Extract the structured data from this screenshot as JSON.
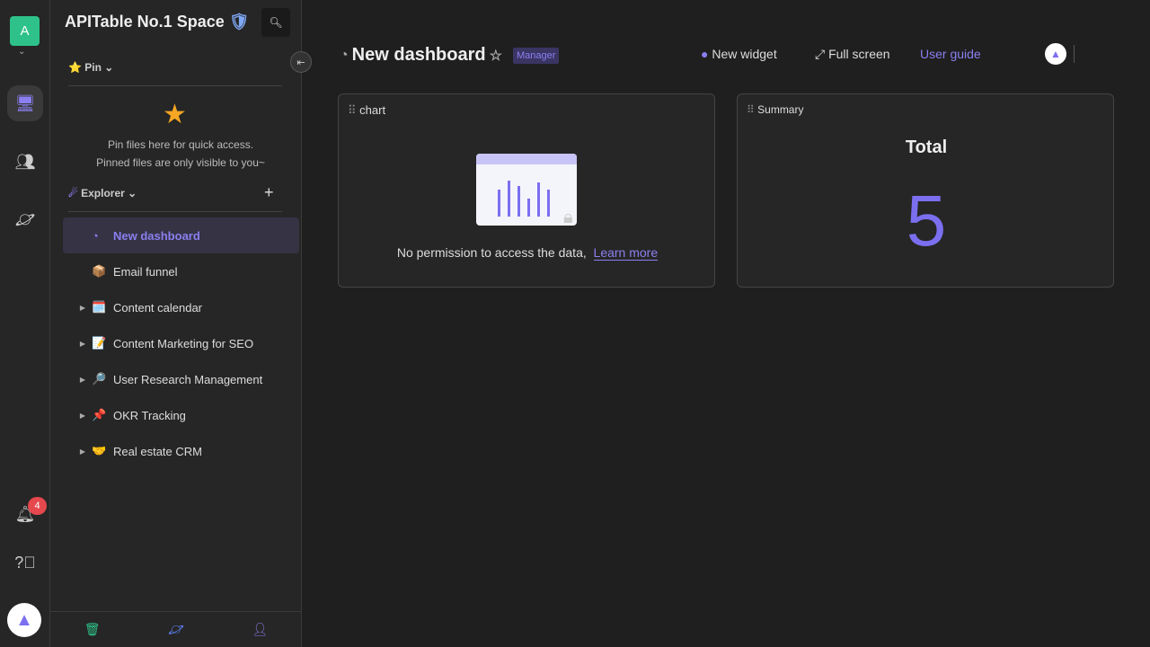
{
  "rail": {
    "avatar_letter": "A",
    "notification_count": "4"
  },
  "sidebar": {
    "space_name": "APITable No.1 Space",
    "pin_label": "Pin",
    "pin_msg1": "Pin files here for quick access.",
    "pin_msg2": "Pinned files are only visible to you~",
    "explorer_label": "Explorer",
    "items": [
      {
        "label": "New dashboard",
        "icon": "dashboard-icon",
        "active": true
      },
      {
        "label": "Email funnel",
        "emoji": "📦"
      },
      {
        "label": "Content calendar",
        "emoji": "🗓️"
      },
      {
        "label": "Content Marketing for SEO",
        "emoji": "📝"
      },
      {
        "label": "User Research Management",
        "emoji": "🔎"
      },
      {
        "label": "OKR Tracking",
        "emoji": "📌"
      },
      {
        "label": "Real estate CRM",
        "emoji": "🤝"
      }
    ]
  },
  "header": {
    "title": "New dashboard",
    "role_badge": "Manager",
    "new_widget": "New widget",
    "full_screen": "Full screen",
    "user_guide": "User guide"
  },
  "widgets": {
    "chart": {
      "title": "chart",
      "message": "No permission to access the data,",
      "link": "Learn more"
    },
    "summary": {
      "title": "Summary",
      "label": "Total",
      "value": "5"
    }
  },
  "colors": {
    "accent": "#7b6ff0",
    "avatar": "#2ec28a"
  }
}
